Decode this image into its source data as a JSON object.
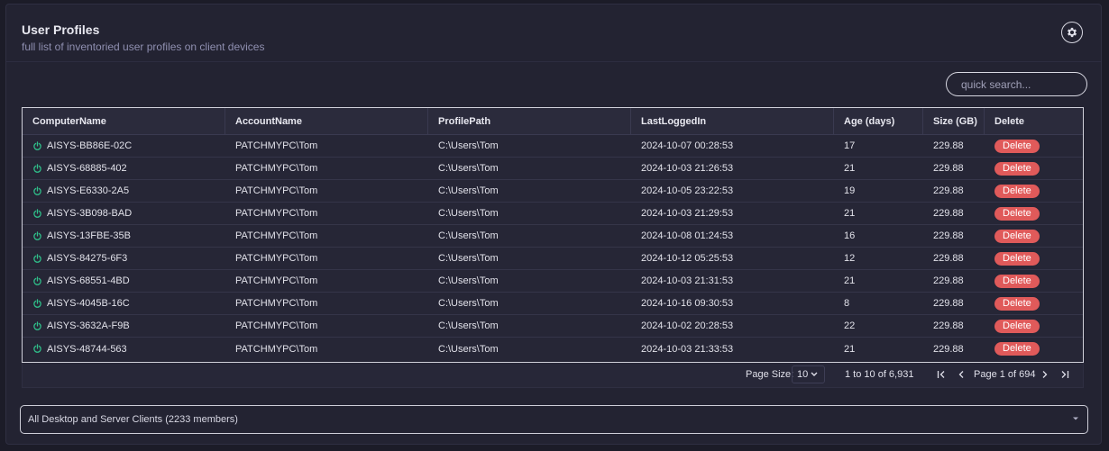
{
  "header": {
    "title": "User Profiles",
    "subtitle": "full list of inventoried user profiles on client devices"
  },
  "search": {
    "placeholder": "quick search..."
  },
  "table": {
    "columns": [
      "ComputerName",
      "AccountName",
      "ProfilePath",
      "LastLoggedIn",
      "Age (days)",
      "Size (GB)",
      "Delete"
    ],
    "delete_label": "Delete",
    "rows": [
      {
        "computer": "AISYS-BB86E-02C",
        "account": "PATCHMYPC\\Tom",
        "path": "C:\\Users\\Tom",
        "last": "2024-10-07 00:28:53",
        "age": "17",
        "size": "229.88"
      },
      {
        "computer": "AISYS-68885-402",
        "account": "PATCHMYPC\\Tom",
        "path": "C:\\Users\\Tom",
        "last": "2024-10-03 21:26:53",
        "age": "21",
        "size": "229.88"
      },
      {
        "computer": "AISYS-E6330-2A5",
        "account": "PATCHMYPC\\Tom",
        "path": "C:\\Users\\Tom",
        "last": "2024-10-05 23:22:53",
        "age": "19",
        "size": "229.88"
      },
      {
        "computer": "AISYS-3B098-BAD",
        "account": "PATCHMYPC\\Tom",
        "path": "C:\\Users\\Tom",
        "last": "2024-10-03 21:29:53",
        "age": "21",
        "size": "229.88"
      },
      {
        "computer": "AISYS-13FBE-35B",
        "account": "PATCHMYPC\\Tom",
        "path": "C:\\Users\\Tom",
        "last": "2024-10-08 01:24:53",
        "age": "16",
        "size": "229.88"
      },
      {
        "computer": "AISYS-84275-6F3",
        "account": "PATCHMYPC\\Tom",
        "path": "C:\\Users\\Tom",
        "last": "2024-10-12 05:25:53",
        "age": "12",
        "size": "229.88"
      },
      {
        "computer": "AISYS-68551-4BD",
        "account": "PATCHMYPC\\Tom",
        "path": "C:\\Users\\Tom",
        "last": "2024-10-03 21:31:53",
        "age": "21",
        "size": "229.88"
      },
      {
        "computer": "AISYS-4045B-16C",
        "account": "PATCHMYPC\\Tom",
        "path": "C:\\Users\\Tom",
        "last": "2024-10-16 09:30:53",
        "age": "8",
        "size": "229.88"
      },
      {
        "computer": "AISYS-3632A-F9B",
        "account": "PATCHMYPC\\Tom",
        "path": "C:\\Users\\Tom",
        "last": "2024-10-02 20:28:53",
        "age": "22",
        "size": "229.88"
      },
      {
        "computer": "AISYS-48744-563",
        "account": "PATCHMYPC\\Tom",
        "path": "C:\\Users\\Tom",
        "last": "2024-10-03 21:33:53",
        "age": "21",
        "size": "229.88"
      }
    ]
  },
  "pagination": {
    "page_size_label": "Page Size:",
    "page_size": "10",
    "range": "1 to 10 of 6,931",
    "page_text": "Page 1 of 694"
  },
  "group_select": {
    "value": "All Desktop and Server Clients (2233 members)"
  },
  "colors": {
    "background": "#1c1c28",
    "panel": "#232332",
    "delete": "#e05a5a",
    "power": "#2fc08a"
  },
  "icons": {
    "settings": "gear-icon",
    "status": "power-icon",
    "dropdown": "chevron-down-icon"
  }
}
